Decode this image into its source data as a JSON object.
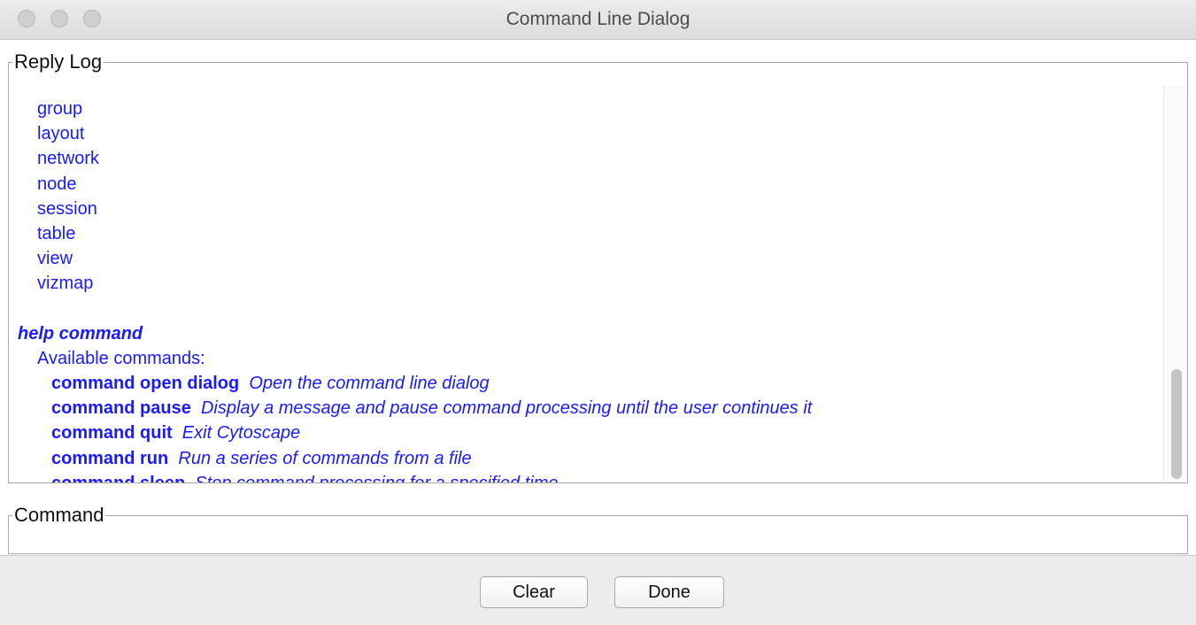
{
  "window": {
    "title": "Command Line Dialog"
  },
  "reply_log": {
    "legend": "Reply Log",
    "namespaces": [
      "group",
      "layout",
      "network",
      "node",
      "session",
      "table",
      "view",
      "vizmap"
    ],
    "help_header": "help command",
    "available_label": "Available commands:",
    "commands": [
      {
        "name": "command open dialog",
        "description": "Open the command line dialog"
      },
      {
        "name": "command pause",
        "description": "Display a message and pause command processing until the user continues it"
      },
      {
        "name": "command quit",
        "description": "Exit Cytoscape"
      },
      {
        "name": "command run",
        "description": "Run a series of commands from a file"
      },
      {
        "name": "command sleep",
        "description": "Stop command processing for a specified time"
      }
    ]
  },
  "command": {
    "legend": "Command",
    "value": ""
  },
  "buttons": {
    "clear": "Clear",
    "done": "Done"
  }
}
